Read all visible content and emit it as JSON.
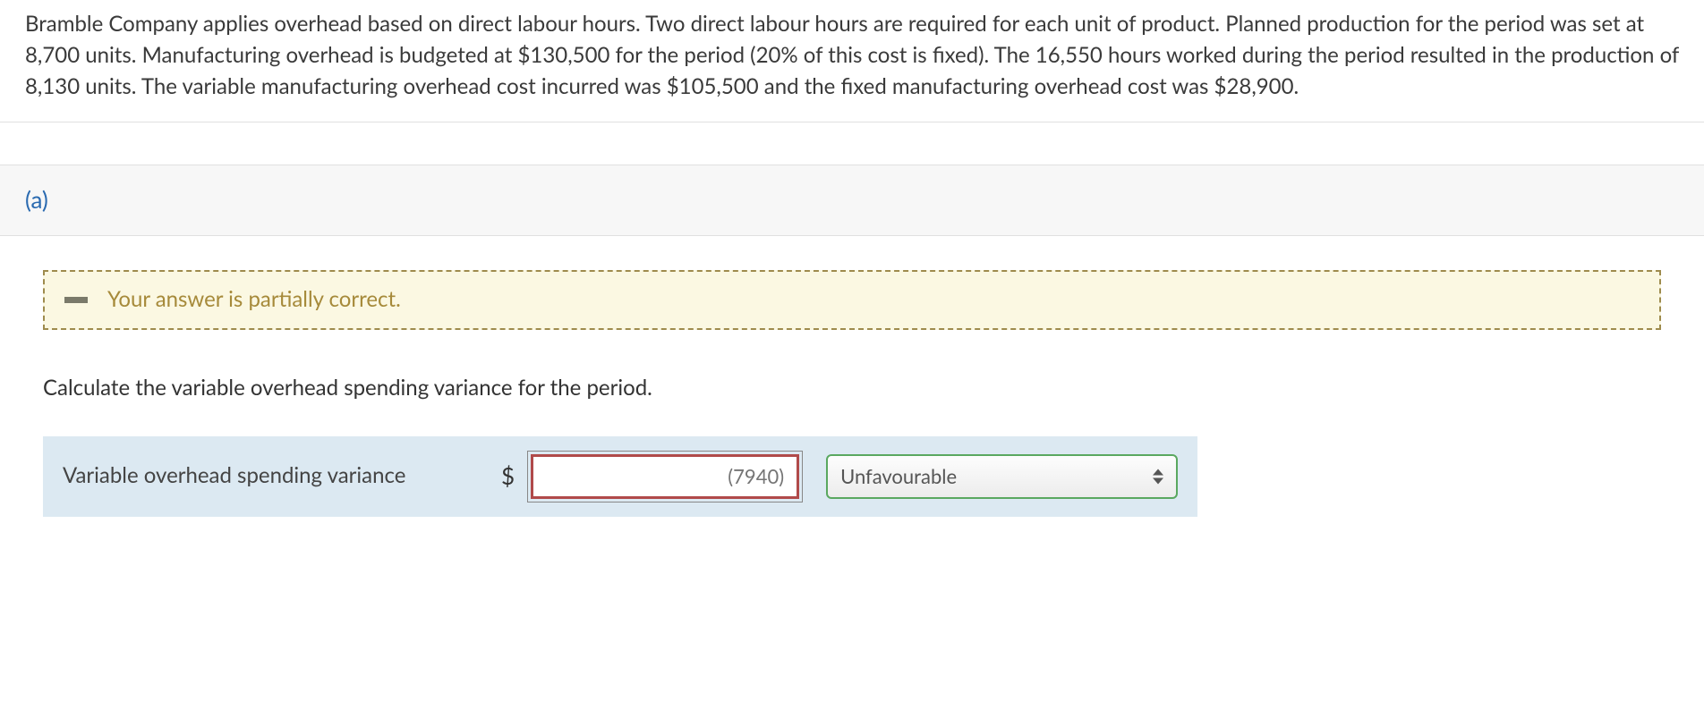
{
  "problem": {
    "text": "Bramble Company applies overhead based on direct labour hours. Two direct labour hours are required for each unit of product. Planned production for the period was set at 8,700 units. Manufacturing overhead is budgeted at $130,500 for the period (20% of this cost is fixed). The 16,550 hours worked during the period resulted in the production of 8,130 units. The variable manufacturing overhead cost incurred was $105,500 and the fixed manufacturing overhead cost was $28,900."
  },
  "part": {
    "label": "(a)"
  },
  "feedback": {
    "message": "Your answer is partially correct."
  },
  "instruction": "Calculate the variable overhead spending variance for the period.",
  "answer": {
    "label": "Variable overhead spending variance",
    "currency": "$",
    "value_placeholder": "(7940)",
    "direction_selected": "Unfavourable"
  }
}
